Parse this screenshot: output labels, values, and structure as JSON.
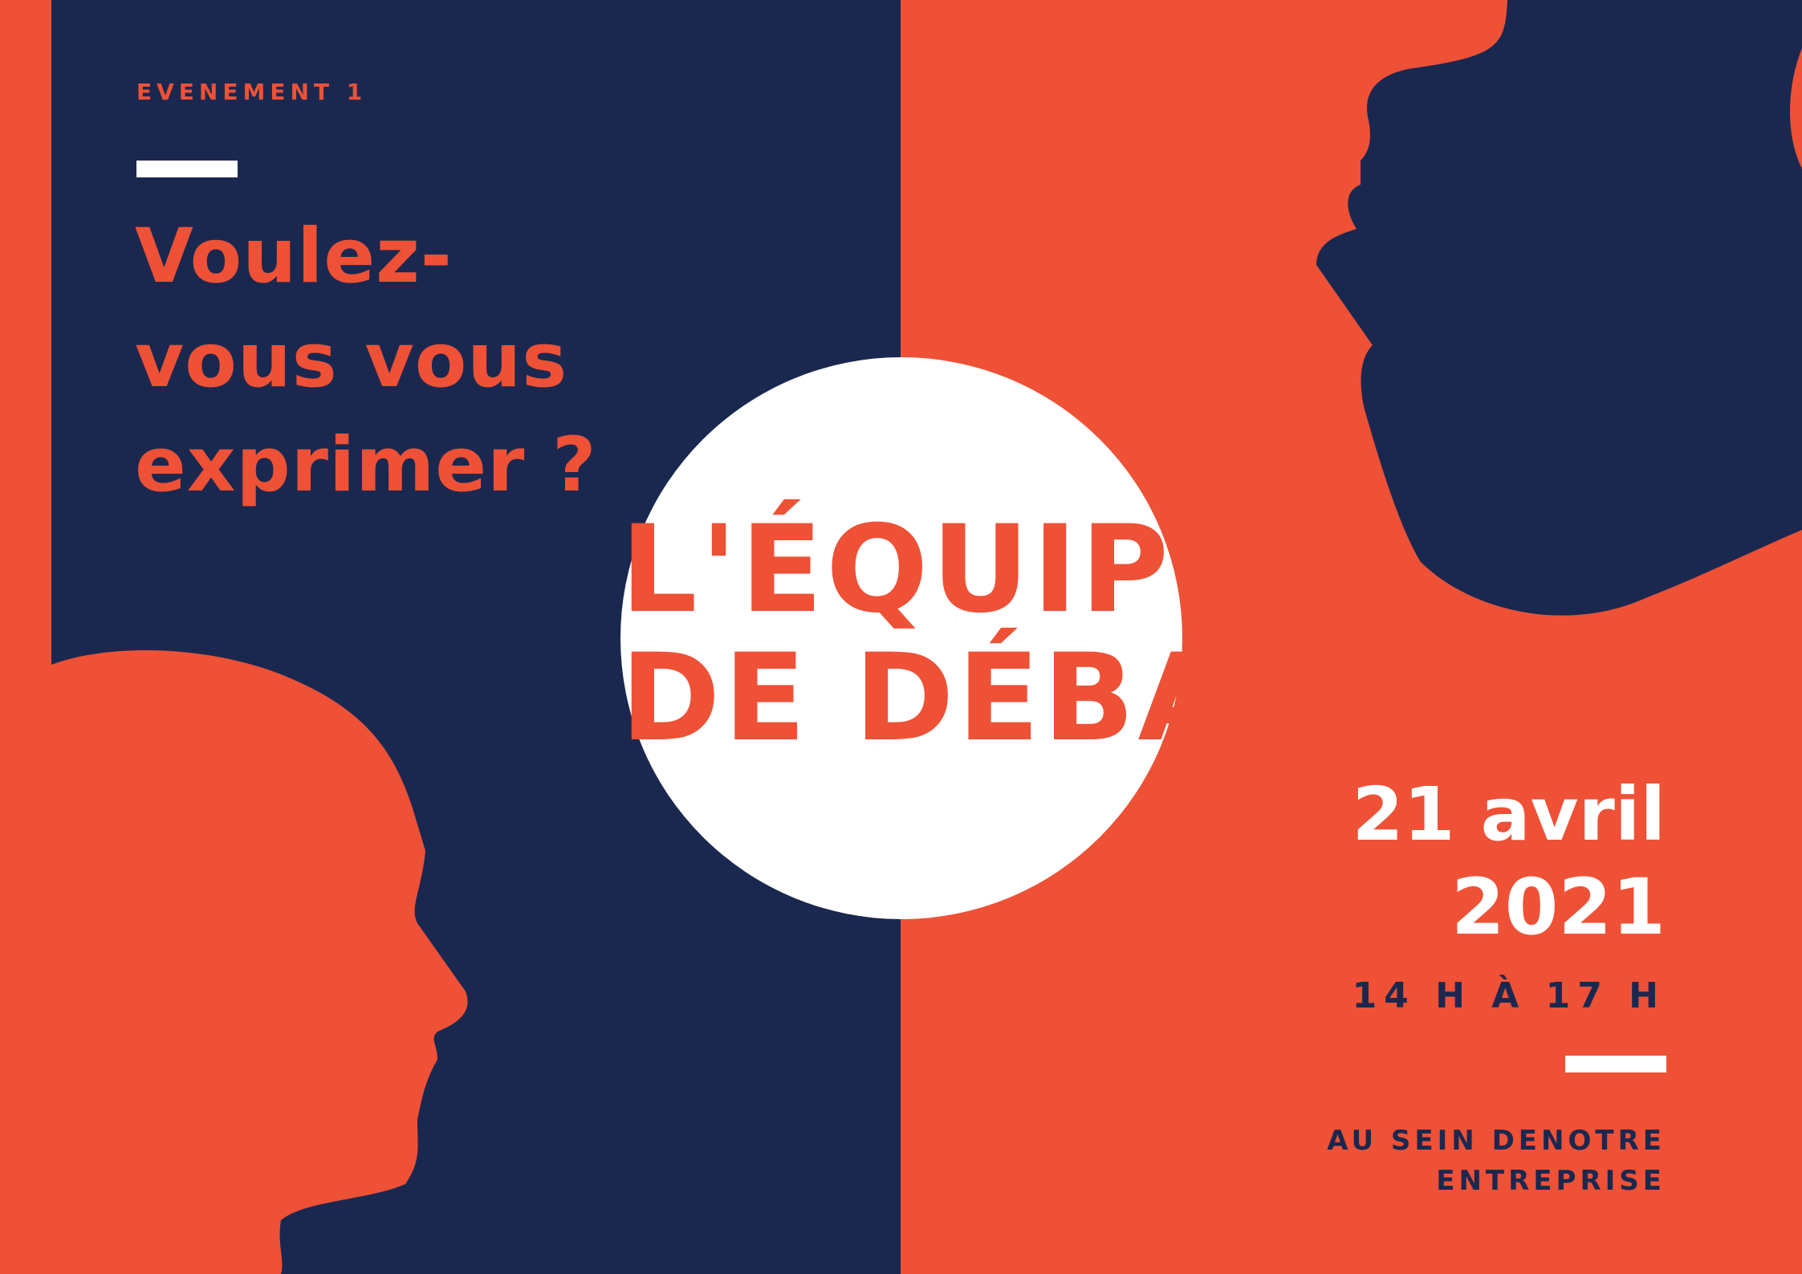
{
  "colors": {
    "orange": "#EE5136",
    "navy": "#1A2850",
    "white": "#FFFFFF"
  },
  "event_label": "EVENEMENT 1",
  "question": [
    "Voulez-",
    "vous vous",
    "exprimer ?"
  ],
  "title": [
    "L'ÉQUIPE",
    "DE DÉBAT"
  ],
  "date": {
    "day_month": "21 avril",
    "year": "2021"
  },
  "time": "14 H À 17 H",
  "venue": [
    "AU SEIN DENOTRE",
    "ENTREPRISE"
  ]
}
